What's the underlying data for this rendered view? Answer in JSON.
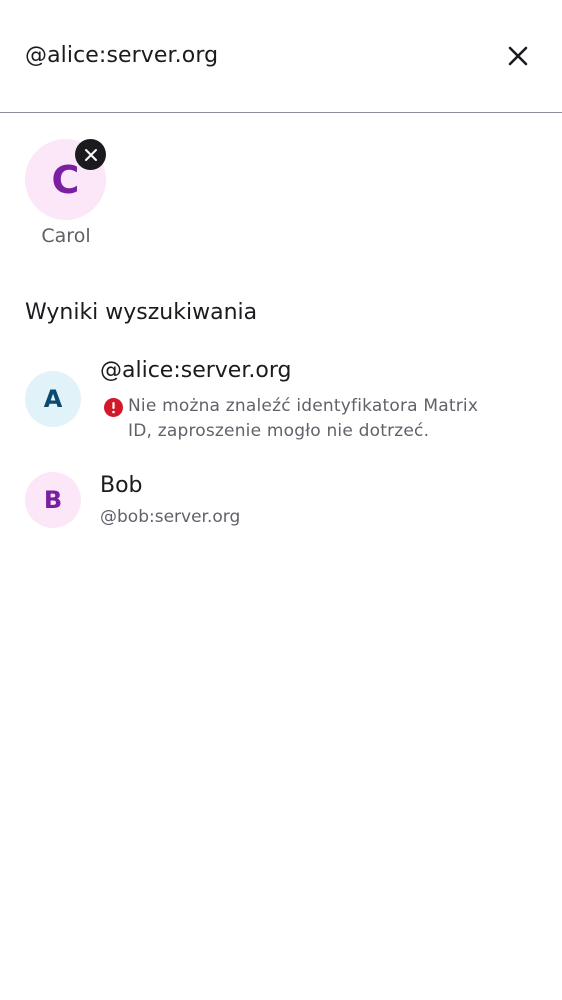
{
  "search": {
    "query": "@alice:server.org"
  },
  "selected": [
    {
      "initial": "C",
      "name": "Carol"
    }
  ],
  "results_section": {
    "title": "Wyniki wyszukiwania"
  },
  "results": [
    {
      "initial": "A",
      "title": "@alice:server.org",
      "warning": "Nie można znaleźć identyfikatora Matrix ID, zaproszenie mogło nie dotrzeć.",
      "avatar_color": "#e1f2f9",
      "initial_color": "#0b4a6e"
    },
    {
      "initial": "B",
      "title": "Bob",
      "subtitle": "@bob:server.org",
      "avatar_color": "#fbe7f8",
      "initial_color": "#7b1fa2"
    }
  ],
  "colors": {
    "error": "#d1192b",
    "divider": "#8e8a99",
    "text_secondary": "#62616a"
  },
  "icons": {
    "close": "close-icon",
    "remove": "remove-icon",
    "warning": "error-icon"
  }
}
